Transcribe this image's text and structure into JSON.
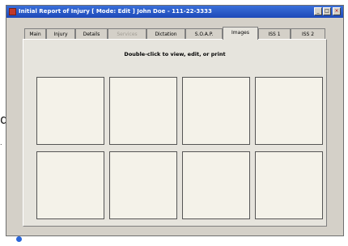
{
  "background": {
    "left_text": "d"
  },
  "window": {
    "title": "Initial Report of Injury  [ Mode: Edit ]  John Doe - 111-22-3333",
    "minimize_label": "_",
    "maximize_label": "□",
    "close_label": "×"
  },
  "tabs": [
    {
      "label": "Main",
      "state": "normal"
    },
    {
      "label": "Injury",
      "state": "normal"
    },
    {
      "label": "Details",
      "state": "normal"
    },
    {
      "label": "Services",
      "state": "disabled"
    },
    {
      "label": "Dictation",
      "state": "normal"
    },
    {
      "label": "S.O.A.P.",
      "state": "normal"
    },
    {
      "label": "Images",
      "state": "active"
    },
    {
      "label": "ISS 1",
      "state": "normal"
    },
    {
      "label": "ISS 2",
      "state": "normal"
    }
  ],
  "images_panel": {
    "instruction": "Double-click to view, edit, or print",
    "tile_count": 8
  },
  "colors": {
    "title_bar": "#1d49b8",
    "panel_bg": "#e6e4dd",
    "tile_bg": "#f4f2e9"
  }
}
